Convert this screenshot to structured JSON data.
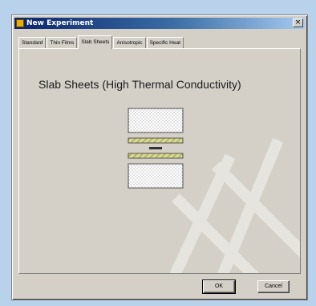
{
  "window": {
    "title": "New Experiment",
    "close_glyph": "×"
  },
  "tabs": [
    {
      "label": "Standard",
      "active": false
    },
    {
      "label": "Thin Films",
      "active": false
    },
    {
      "label": "Slab Sheets",
      "active": true
    },
    {
      "label": "Anisotropic",
      "active": false
    },
    {
      "label": "Specific Heat",
      "active": false
    }
  ],
  "panel": {
    "heading": "Slab Sheets (High Thermal Conductivity)"
  },
  "buttons": {
    "ok_label": "OK",
    "cancel_label": "Cancel"
  },
  "icons": {
    "title_icon": "app-icon",
    "close_icon": "close-icon"
  },
  "colors": {
    "title_bar_start": "#0a246a",
    "title_bar_end": "#a6caf0",
    "dialog_face": "#d4d0c8",
    "heater_layer": "#c8c870"
  }
}
